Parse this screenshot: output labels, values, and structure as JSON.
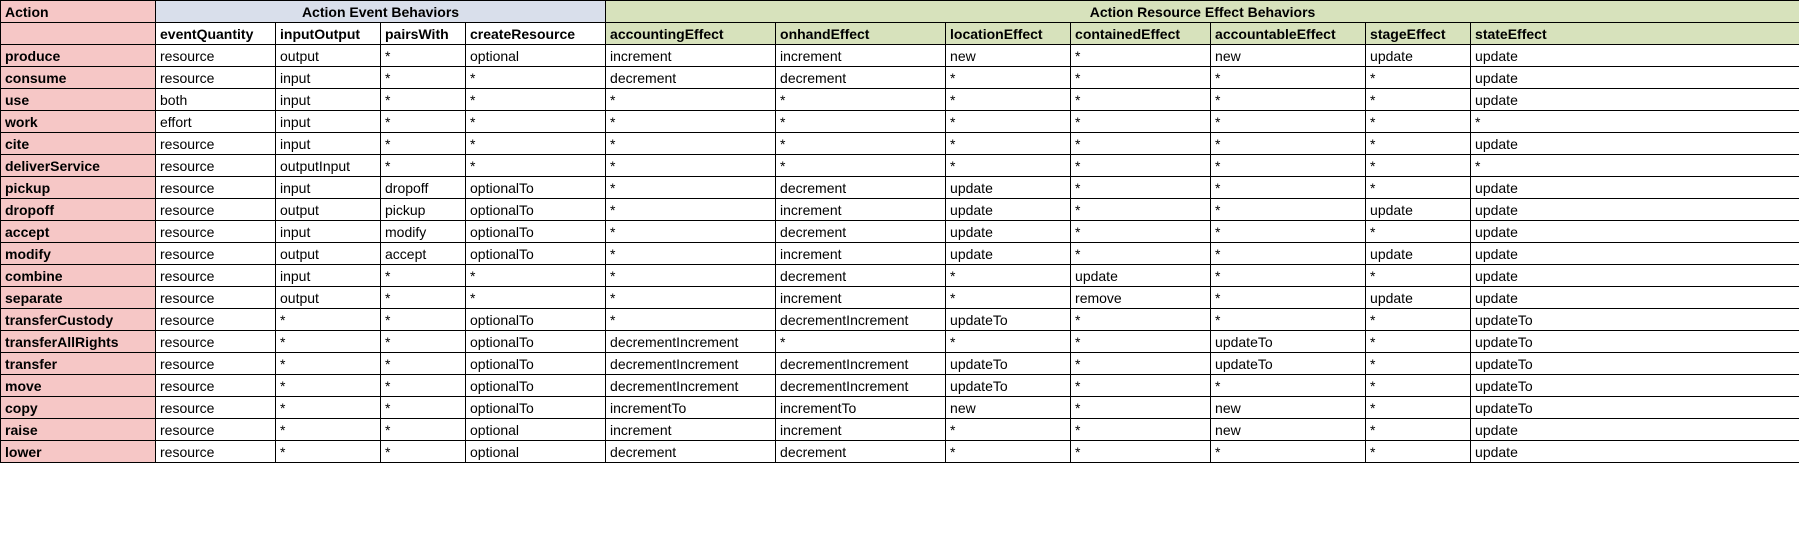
{
  "top": {
    "action": "Action",
    "eventBehaviors": "Action Event Behaviors",
    "resourceBehaviors": "Action Resource Effect Behaviors"
  },
  "sub": {
    "eventQuantity": "eventQuantity",
    "inputOutput": "inputOutput",
    "pairsWith": "pairsWith",
    "createResource": "createResource",
    "accountingEffect": "accountingEffect",
    "onhandEffect": "onhandEffect",
    "locationEffect": "locationEffect",
    "containedEffect": "containedEffect",
    "accountableEffect": "accountableEffect",
    "stageEffect": "stageEffect",
    "stateEffect": "stateEffect"
  },
  "rows": [
    {
      "name": "produce",
      "eventQuantity": "resource",
      "inputOutput": "output",
      "pairsWith": "*",
      "createResource": "optional",
      "accountingEffect": "increment",
      "onhandEffect": "increment",
      "locationEffect": "new",
      "containedEffect": "*",
      "accountableEffect": "new",
      "stageEffect": "update",
      "stateEffect": "update"
    },
    {
      "name": "consume",
      "eventQuantity": "resource",
      "inputOutput": "input",
      "pairsWith": "*",
      "createResource": "*",
      "accountingEffect": "decrement",
      "onhandEffect": "decrement",
      "locationEffect": "*",
      "containedEffect": "*",
      "accountableEffect": "*",
      "stageEffect": "*",
      "stateEffect": "update"
    },
    {
      "name": "use",
      "eventQuantity": "both",
      "inputOutput": "input",
      "pairsWith": "*",
      "createResource": "*",
      "accountingEffect": "*",
      "onhandEffect": "*",
      "locationEffect": "*",
      "containedEffect": "*",
      "accountableEffect": "*",
      "stageEffect": "*",
      "stateEffect": "update"
    },
    {
      "name": "work",
      "eventQuantity": "effort",
      "inputOutput": "input",
      "pairsWith": "*",
      "createResource": "*",
      "accountingEffect": "*",
      "onhandEffect": "*",
      "locationEffect": "*",
      "containedEffect": "*",
      "accountableEffect": "*",
      "stageEffect": "*",
      "stateEffect": "*"
    },
    {
      "name": "cite",
      "eventQuantity": "resource",
      "inputOutput": "input",
      "pairsWith": "*",
      "createResource": "*",
      "accountingEffect": "*",
      "onhandEffect": "*",
      "locationEffect": "*",
      "containedEffect": "*",
      "accountableEffect": "*",
      "stageEffect": "*",
      "stateEffect": "update"
    },
    {
      "name": "deliverService",
      "eventQuantity": "resource",
      "inputOutput": "outputInput",
      "pairsWith": "*",
      "createResource": "*",
      "accountingEffect": "*",
      "onhandEffect": "*",
      "locationEffect": "*",
      "containedEffect": "*",
      "accountableEffect": "*",
      "stageEffect": "*",
      "stateEffect": "*"
    },
    {
      "name": "pickup",
      "eventQuantity": "resource",
      "inputOutput": "input",
      "pairsWith": "dropoff",
      "createResource": "optionalTo",
      "accountingEffect": "*",
      "onhandEffect": "decrement",
      "locationEffect": "update",
      "containedEffect": "*",
      "accountableEffect": "*",
      "stageEffect": "*",
      "stateEffect": "update"
    },
    {
      "name": "dropoff",
      "eventQuantity": "resource",
      "inputOutput": "output",
      "pairsWith": "pickup",
      "createResource": "optionalTo",
      "accountingEffect": "*",
      "onhandEffect": "increment",
      "locationEffect": "update",
      "containedEffect": "*",
      "accountableEffect": "*",
      "stageEffect": "update",
      "stateEffect": "update"
    },
    {
      "name": "accept",
      "eventQuantity": "resource",
      "inputOutput": "input",
      "pairsWith": "modify",
      "createResource": "optionalTo",
      "accountingEffect": "*",
      "onhandEffect": "decrement",
      "locationEffect": "update",
      "containedEffect": "*",
      "accountableEffect": "*",
      "stageEffect": "*",
      "stateEffect": "update"
    },
    {
      "name": "modify",
      "eventQuantity": "resource",
      "inputOutput": "output",
      "pairsWith": "accept",
      "createResource": "optionalTo",
      "accountingEffect": "*",
      "onhandEffect": "increment",
      "locationEffect": "update",
      "containedEffect": "*",
      "accountableEffect": "*",
      "stageEffect": "update",
      "stateEffect": "update"
    },
    {
      "name": "combine",
      "eventQuantity": "resource",
      "inputOutput": "input",
      "pairsWith": "*",
      "createResource": "*",
      "accountingEffect": "*",
      "onhandEffect": "decrement",
      "locationEffect": "*",
      "containedEffect": "update",
      "accountableEffect": "*",
      "stageEffect": "*",
      "stateEffect": "update"
    },
    {
      "name": "separate",
      "eventQuantity": "resource",
      "inputOutput": "output",
      "pairsWith": "*",
      "createResource": "*",
      "accountingEffect": "*",
      "onhandEffect": "increment",
      "locationEffect": "*",
      "containedEffect": "remove",
      "accountableEffect": "*",
      "stageEffect": "update",
      "stateEffect": "update"
    },
    {
      "name": "transferCustody",
      "eventQuantity": "resource",
      "inputOutput": "*",
      "pairsWith": "*",
      "createResource": "optionalTo",
      "accountingEffect": "*",
      "onhandEffect": "decrementIncrement",
      "locationEffect": "updateTo",
      "containedEffect": "*",
      "accountableEffect": "*",
      "stageEffect": "*",
      "stateEffect": "updateTo"
    },
    {
      "name": "transferAllRights",
      "eventQuantity": "resource",
      "inputOutput": "*",
      "pairsWith": "*",
      "createResource": "optionalTo",
      "accountingEffect": "decrementIncrement",
      "onhandEffect": "*",
      "locationEffect": "*",
      "containedEffect": "*",
      "accountableEffect": "updateTo",
      "stageEffect": "*",
      "stateEffect": "updateTo"
    },
    {
      "name": "transfer",
      "eventQuantity": "resource",
      "inputOutput": "*",
      "pairsWith": "*",
      "createResource": "optionalTo",
      "accountingEffect": "decrementIncrement",
      "onhandEffect": "decrementIncrement",
      "locationEffect": "updateTo",
      "containedEffect": "*",
      "accountableEffect": "updateTo",
      "stageEffect": "*",
      "stateEffect": "updateTo"
    },
    {
      "name": "move",
      "eventQuantity": "resource",
      "inputOutput": "*",
      "pairsWith": "*",
      "createResource": "optionalTo",
      "accountingEffect": "decrementIncrement",
      "onhandEffect": "decrementIncrement",
      "locationEffect": "updateTo",
      "containedEffect": "*",
      "accountableEffect": "*",
      "stageEffect": "*",
      "stateEffect": "updateTo"
    },
    {
      "name": "copy",
      "eventQuantity": "resource",
      "inputOutput": "*",
      "pairsWith": "*",
      "createResource": "optionalTo",
      "accountingEffect": "incrementTo",
      "onhandEffect": "incrementTo",
      "locationEffect": "new",
      "containedEffect": "*",
      "accountableEffect": "new",
      "stageEffect": "*",
      "stateEffect": "updateTo"
    },
    {
      "name": "raise",
      "eventQuantity": "resource",
      "inputOutput": "*",
      "pairsWith": "*",
      "createResource": "optional",
      "accountingEffect": "increment",
      "onhandEffect": "increment",
      "locationEffect": "*",
      "containedEffect": "*",
      "accountableEffect": "new",
      "stageEffect": "*",
      "stateEffect": "update"
    },
    {
      "name": "lower",
      "eventQuantity": "resource",
      "inputOutput": "*",
      "pairsWith": "*",
      "createResource": "optional",
      "accountingEffect": "decrement",
      "onhandEffect": "decrement",
      "locationEffect": "*",
      "containedEffect": "*",
      "accountableEffect": "*",
      "stageEffect": "*",
      "stateEffect": "update"
    }
  ]
}
